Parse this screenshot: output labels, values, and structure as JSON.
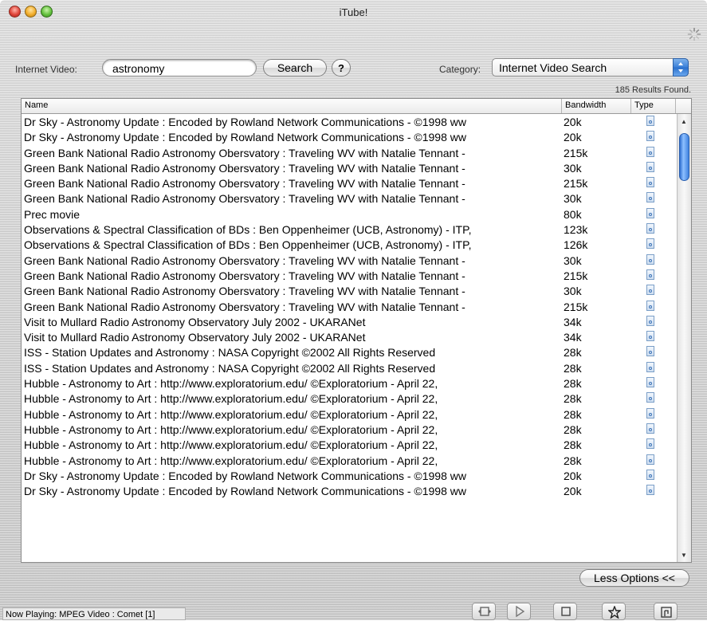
{
  "window": {
    "title": "iTube!"
  },
  "search": {
    "label": "Internet Video:",
    "value": "astronomy",
    "button_label": "Search",
    "help_label": "?"
  },
  "category": {
    "label": "Category:",
    "selected": "Internet Video Search"
  },
  "results_count": "185 Results Found.",
  "table": {
    "columns": [
      "Name",
      "Bandwidth",
      "Type"
    ],
    "rows": [
      {
        "name": "Dr Sky - Astronomy Update : Encoded by Rowland Network Communications - ©1998 ww",
        "bandwidth": "20k"
      },
      {
        "name": "Dr Sky - Astronomy Update : Encoded by Rowland Network Communications - ©1998 ww",
        "bandwidth": "20k"
      },
      {
        "name": "Green Bank National Radio Astronomy Obersvatory : Traveling WV with Natalie Tennant -",
        "bandwidth": "215k"
      },
      {
        "name": "Green Bank National Radio Astronomy Obersvatory : Traveling WV with Natalie Tennant -",
        "bandwidth": "30k"
      },
      {
        "name": "Green Bank National Radio Astronomy Obersvatory : Traveling WV with Natalie Tennant -",
        "bandwidth": "215k"
      },
      {
        "name": "Green Bank National Radio Astronomy Obersvatory : Traveling WV with Natalie Tennant -",
        "bandwidth": "30k"
      },
      {
        "name": "Prec movie",
        "bandwidth": "80k"
      },
      {
        "name": "Observations & Spectral Classification of BDs : Ben Oppenheimer (UCB, Astronomy) - ITP,",
        "bandwidth": "123k"
      },
      {
        "name": "Observations & Spectral Classification of BDs : Ben Oppenheimer (UCB, Astronomy) - ITP,",
        "bandwidth": "126k"
      },
      {
        "name": "Green Bank National Radio Astronomy Obersvatory : Traveling WV with Natalie Tennant -",
        "bandwidth": "30k"
      },
      {
        "name": "Green Bank National Radio Astronomy Obersvatory : Traveling WV with Natalie Tennant -",
        "bandwidth": "215k"
      },
      {
        "name": "Green Bank National Radio Astronomy Obersvatory : Traveling WV with Natalie Tennant -",
        "bandwidth": "30k"
      },
      {
        "name": "Green Bank National Radio Astronomy Obersvatory : Traveling WV with Natalie Tennant -",
        "bandwidth": "215k"
      },
      {
        "name": "Visit to Mullard Radio Astronomy Observatory July 2002 - UKARANet",
        "bandwidth": "34k"
      },
      {
        "name": "Visit to Mullard Radio Astronomy Observatory July 2002 - UKARANet",
        "bandwidth": "34k"
      },
      {
        "name": "ISS - Station Updates and Astronomy : NASA Copyright ©2002 All Rights Reserved",
        "bandwidth": "28k"
      },
      {
        "name": "ISS - Station Updates and Astronomy : NASA Copyright ©2002 All Rights Reserved",
        "bandwidth": "28k"
      },
      {
        "name": "Hubble - Astronomy to Art : http://www.exploratorium.edu/ ©Exploratorium - April 22,",
        "bandwidth": "28k"
      },
      {
        "name": "Hubble - Astronomy to Art : http://www.exploratorium.edu/ ©Exploratorium - April 22,",
        "bandwidth": "28k"
      },
      {
        "name": "Hubble - Astronomy to Art : http://www.exploratorium.edu/ ©Exploratorium - April 22,",
        "bandwidth": "28k"
      },
      {
        "name": "Hubble - Astronomy to Art : http://www.exploratorium.edu/ ©Exploratorium - April 22,",
        "bandwidth": "28k"
      },
      {
        "name": "Hubble - Astronomy to Art : http://www.exploratorium.edu/ ©Exploratorium - April 22,",
        "bandwidth": "28k"
      },
      {
        "name": "Hubble - Astronomy to Art : http://www.exploratorium.edu/ ©Exploratorium - April 22,",
        "bandwidth": "28k"
      },
      {
        "name": "Dr Sky - Astronomy Update : Encoded by Rowland Network Communications - ©1998 ww",
        "bandwidth": "20k"
      },
      {
        "name": "Dr Sky - Astronomy Update : Encoded by Rowland Network Communications - ©1998 ww",
        "bandwidth": "20k"
      }
    ],
    "type_icon": "video-file-icon"
  },
  "options_button": "Less Options <<",
  "status": "Now Playing: MPEG Video : Comet [1]",
  "controls": [
    "fullscreen-icon",
    "play-icon",
    "stop-icon",
    "favorite-icon",
    "export-icon"
  ]
}
